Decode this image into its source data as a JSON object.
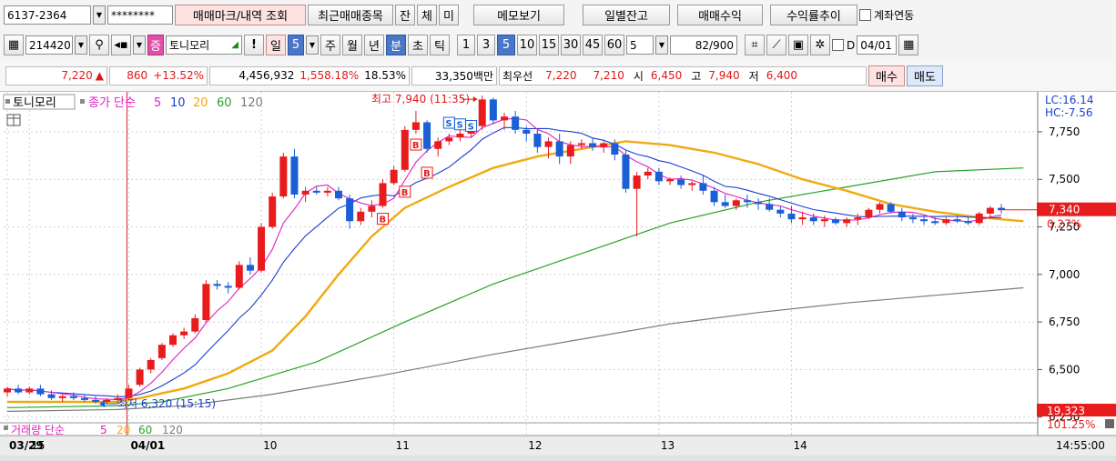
{
  "row1": {
    "account": "6137-2364",
    "password": "********",
    "btn_trade_mark": "매매마크/내역 조회",
    "btn_recent": "최근매매종목",
    "btn_jan": "잔",
    "btn_che": "체",
    "btn_mi": "미",
    "btn_memo": "메모보기",
    "btn_daily": "일별잔고",
    "btn_profit": "매매수익",
    "btn_return": "수익률추이",
    "link_label": "계좌연동"
  },
  "row2": {
    "code": "214420",
    "tag": "증",
    "stock_name": "토니모리",
    "excl": "!",
    "periods": [
      "일",
      "5",
      "주",
      "월",
      "년",
      "분",
      "초",
      "틱"
    ],
    "intervals": [
      "1",
      "3",
      "5",
      "10",
      "15",
      "30",
      "45",
      "60"
    ],
    "count_value": "5",
    "range_value": "82",
    "range_total": "/900",
    "date_value": "04/01",
    "d_label": "D"
  },
  "quote": {
    "price": "7,220",
    "change": "860",
    "change_pct": "+13.52%",
    "volume": "4,456,932",
    "vol_ratio": "1,558.18%",
    "turnover": "18.53%",
    "amount": "33,350백만",
    "best_label": "최우선",
    "ask": "7,220",
    "bid": "7,210",
    "open_label": "시",
    "open": "6,450",
    "high_label": "고",
    "high": "7,940",
    "low_label": "저",
    "low": "6,400",
    "buy_label": "매수",
    "sell_label": "매도"
  },
  "chart_legend": {
    "name": "토니모리",
    "ma_label": "종가 단순",
    "ma_periods": [
      "5",
      "10",
      "20",
      "60",
      "120"
    ],
    "vol_label": "거래량 단순",
    "vol_periods": [
      "5",
      "20",
      "60",
      "120"
    ]
  },
  "colors": {
    "up": "#e81c1c",
    "down": "#1a5fd6",
    "ma5": "#e020c0",
    "ma10": "#1a3fd0",
    "ma20": "#f0aa10",
    "ma60": "#2aa12a",
    "ma120": "#7a7a7a",
    "grid": "#cfcfcf",
    "date_line": "#e02020"
  },
  "chart_data": {
    "type": "candlestick",
    "y_ticks": [
      "7,750",
      "7,500",
      "7,250",
      "7,000",
      "6,750",
      "6,500",
      "6,250"
    ],
    "ylim": [
      6220,
      7960
    ],
    "x_labels": [
      {
        "i": 0,
        "text": "03/29"
      },
      {
        "i": 2,
        "text": "15"
      },
      {
        "i": 11,
        "text": "04/01"
      },
      {
        "i": 23,
        "text": "10"
      },
      {
        "i": 35,
        "text": "11"
      },
      {
        "i": 47,
        "text": "12"
      },
      {
        "i": 59,
        "text": "13"
      },
      {
        "i": 71,
        "text": "14"
      }
    ],
    "time_label": "14:55:00",
    "annotations": {
      "high": "최고 7,940 (11:35)",
      "low": "최저 6,320 (15:15)",
      "lc": "LC:16.14",
      "hc": "HC:-7.56",
      "current_price": "7,340",
      "current_pct": "0.27%",
      "vol_value": "19,323",
      "vol_pct": "101.25%"
    },
    "candles": [
      [
        6380,
        6410,
        6360,
        6400
      ],
      [
        6400,
        6420,
        6370,
        6380
      ],
      [
        6380,
        6410,
        6370,
        6400
      ],
      [
        6400,
        6420,
        6360,
        6370
      ],
      [
        6370,
        6390,
        6340,
        6350
      ],
      [
        6350,
        6370,
        6330,
        6360
      ],
      [
        6360,
        6380,
        6340,
        6350
      ],
      [
        6350,
        6370,
        6330,
        6340
      ],
      [
        6340,
        6360,
        6320,
        6330
      ],
      [
        6330,
        6350,
        6320,
        6340
      ],
      [
        6340,
        6370,
        6320,
        6350
      ],
      [
        6350,
        6420,
        6340,
        6400
      ],
      [
        6420,
        6510,
        6410,
        6500
      ],
      [
        6500,
        6560,
        6480,
        6550
      ],
      [
        6560,
        6640,
        6550,
        6630
      ],
      [
        6630,
        6690,
        6620,
        6680
      ],
      [
        6680,
        6720,
        6660,
        6700
      ],
      [
        6700,
        6790,
        6690,
        6770
      ],
      [
        6760,
        6970,
        6750,
        6950
      ],
      [
        6950,
        6970,
        6920,
        6940
      ],
      [
        6940,
        6960,
        6900,
        6930
      ],
      [
        6930,
        7070,
        6920,
        7050
      ],
      [
        7050,
        7090,
        7000,
        7020
      ],
      [
        7020,
        7270,
        7010,
        7250
      ],
      [
        7250,
        7430,
        7240,
        7410
      ],
      [
        7410,
        7640,
        7400,
        7620
      ],
      [
        7620,
        7660,
        7400,
        7420
      ],
      [
        7420,
        7460,
        7380,
        7440
      ],
      [
        7440,
        7460,
        7420,
        7430
      ],
      [
        7430,
        7460,
        7410,
        7440
      ],
      [
        7440,
        7460,
        7390,
        7400
      ],
      [
        7400,
        7420,
        7240,
        7280
      ],
      [
        7280,
        7350,
        7260,
        7330
      ],
      [
        7330,
        7390,
        7300,
        7360
      ],
      [
        7360,
        7500,
        7350,
        7480
      ],
      [
        7480,
        7570,
        7470,
        7550
      ],
      [
        7550,
        7780,
        7540,
        7760
      ],
      [
        7760,
        7860,
        7740,
        7800
      ],
      [
        7800,
        7810,
        7640,
        7660
      ],
      [
        7660,
        7720,
        7620,
        7700
      ],
      [
        7700,
        7740,
        7680,
        7720
      ],
      [
        7720,
        7770,
        7700,
        7740
      ],
      [
        7740,
        7800,
        7720,
        7780
      ],
      [
        7780,
        7940,
        7760,
        7920
      ],
      [
        7920,
        7930,
        7790,
        7810
      ],
      [
        7810,
        7850,
        7760,
        7830
      ],
      [
        7830,
        7860,
        7740,
        7760
      ],
      [
        7760,
        7780,
        7700,
        7740
      ],
      [
        7740,
        7760,
        7640,
        7670
      ],
      [
        7670,
        7720,
        7610,
        7700
      ],
      [
        7700,
        7740,
        7580,
        7620
      ],
      [
        7620,
        7700,
        7580,
        7680
      ],
      [
        7680,
        7710,
        7660,
        7690
      ],
      [
        7690,
        7720,
        7650,
        7670
      ],
      [
        7670,
        7700,
        7640,
        7690
      ],
      [
        7690,
        7710,
        7600,
        7630
      ],
      [
        7630,
        7650,
        7430,
        7450
      ],
      [
        7450,
        7540,
        7200,
        7520
      ],
      [
        7520,
        7560,
        7500,
        7540
      ],
      [
        7540,
        7560,
        7470,
        7490
      ],
      [
        7490,
        7510,
        7470,
        7500
      ],
      [
        7500,
        7520,
        7450,
        7470
      ],
      [
        7470,
        7490,
        7440,
        7480
      ],
      [
        7480,
        7520,
        7420,
        7440
      ],
      [
        7440,
        7460,
        7360,
        7380
      ],
      [
        7380,
        7420,
        7350,
        7360
      ],
      [
        7360,
        7400,
        7340,
        7390
      ],
      [
        7390,
        7420,
        7350,
        7380
      ],
      [
        7380,
        7400,
        7340,
        7370
      ],
      [
        7370,
        7400,
        7330,
        7340
      ],
      [
        7340,
        7360,
        7300,
        7320
      ],
      [
        7320,
        7360,
        7270,
        7290
      ],
      [
        7290,
        7330,
        7260,
        7300
      ],
      [
        7300,
        7320,
        7260,
        7280
      ],
      [
        7280,
        7310,
        7250,
        7290
      ],
      [
        7290,
        7300,
        7260,
        7270
      ],
      [
        7270,
        7300,
        7250,
        7290
      ],
      [
        7290,
        7320,
        7260,
        7300
      ],
      [
        7300,
        7350,
        7290,
        7340
      ],
      [
        7340,
        7380,
        7320,
        7370
      ],
      [
        7370,
        7380,
        7320,
        7330
      ],
      [
        7330,
        7350,
        7280,
        7300
      ],
      [
        7300,
        7320,
        7270,
        7290
      ],
      [
        7290,
        7310,
        7260,
        7280
      ],
      [
        7280,
        7300,
        7260,
        7270
      ],
      [
        7270,
        7300,
        7260,
        7290
      ],
      [
        7290,
        7310,
        7270,
        7280
      ],
      [
        7280,
        7300,
        7260,
        7270
      ],
      [
        7270,
        7330,
        7260,
        7320
      ],
      [
        7320,
        7360,
        7300,
        7350
      ],
      [
        7350,
        7370,
        7320,
        7340
      ]
    ],
    "ma20": [
      [
        0,
        6330
      ],
      [
        10,
        6330
      ],
      [
        12,
        6350
      ],
      [
        16,
        6400
      ],
      [
        20,
        6480
      ],
      [
        24,
        6600
      ],
      [
        27,
        6780
      ],
      [
        30,
        7000
      ],
      [
        33,
        7200
      ],
      [
        36,
        7350
      ],
      [
        40,
        7460
      ],
      [
        44,
        7560
      ],
      [
        48,
        7620
      ],
      [
        52,
        7660
      ],
      [
        56,
        7700
      ],
      [
        60,
        7680
      ],
      [
        64,
        7640
      ],
      [
        68,
        7580
      ],
      [
        72,
        7500
      ],
      [
        76,
        7440
      ],
      [
        80,
        7370
      ],
      [
        84,
        7330
      ],
      [
        88,
        7300
      ],
      [
        92,
        7280
      ]
    ],
    "ma60": [
      [
        0,
        6300
      ],
      [
        10,
        6310
      ],
      [
        14,
        6330
      ],
      [
        20,
        6400
      ],
      [
        28,
        6540
      ],
      [
        36,
        6750
      ],
      [
        44,
        6950
      ],
      [
        52,
        7110
      ],
      [
        60,
        7270
      ],
      [
        68,
        7380
      ],
      [
        76,
        7460
      ],
      [
        84,
        7540
      ],
      [
        92,
        7560
      ]
    ],
    "ma120": [
      [
        0,
        6280
      ],
      [
        10,
        6290
      ],
      [
        16,
        6310
      ],
      [
        24,
        6370
      ],
      [
        34,
        6470
      ],
      [
        44,
        6580
      ],
      [
        52,
        6660
      ],
      [
        60,
        6740
      ],
      [
        68,
        6800
      ],
      [
        76,
        6850
      ],
      [
        84,
        6890
      ],
      [
        92,
        6930
      ]
    ],
    "buy_marks": [
      34,
      36,
      37,
      38
    ],
    "sell_marks": [
      40,
      41,
      42
    ]
  }
}
